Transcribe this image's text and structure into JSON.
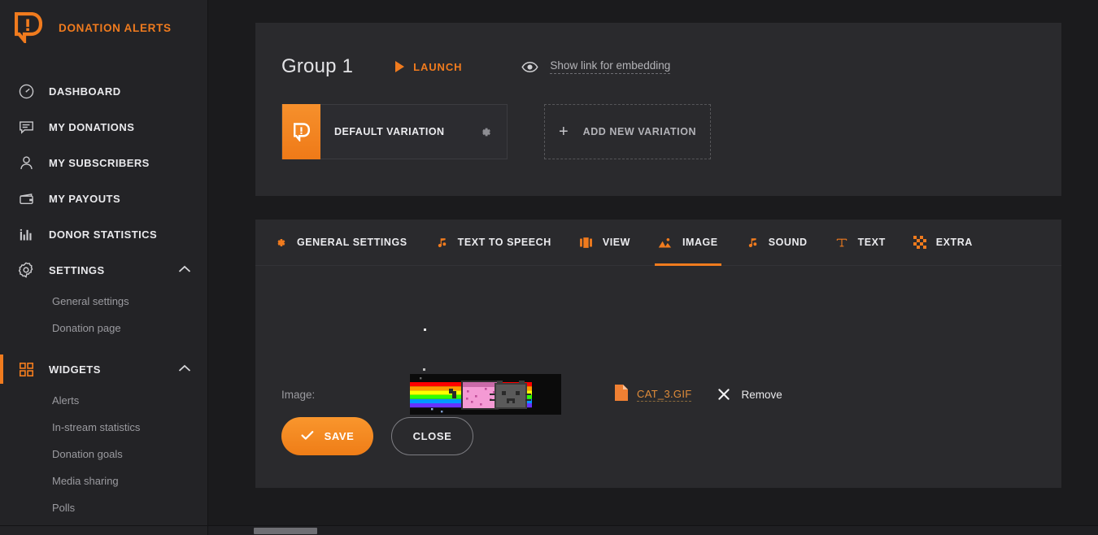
{
  "brand": {
    "name": "DONATION ALERTS",
    "logo_icon": "donation-alerts-logo-icon",
    "accent": "#f07b1e"
  },
  "sidebar": {
    "items": [
      {
        "label": "DASHBOARD",
        "icon": "speedometer-icon"
      },
      {
        "label": "MY DONATIONS",
        "icon": "chat-bubble-icon"
      },
      {
        "label": "MY SUBSCRIBERS",
        "icon": "user-icon"
      },
      {
        "label": "MY PAYOUTS",
        "icon": "wallet-icon"
      },
      {
        "label": "DONOR STATISTICS",
        "icon": "bar-chart-icon"
      },
      {
        "label": "SETTINGS",
        "icon": "gear-icon",
        "chevron": "chevron-up-icon"
      }
    ],
    "settings_children": [
      {
        "label": "General settings"
      },
      {
        "label": "Donation page"
      }
    ],
    "widgets": {
      "label": "WIDGETS",
      "icon": "grid-squares-icon",
      "chevron": "chevron-up-icon",
      "active": true
    },
    "widgets_children": [
      {
        "label": "Alerts"
      },
      {
        "label": "In-stream statistics"
      },
      {
        "label": "Donation goals"
      },
      {
        "label": "Media sharing"
      },
      {
        "label": "Polls"
      }
    ]
  },
  "header": {
    "group_title": "Group 1",
    "launch_label": "LAUNCH",
    "launch_icon": "play-triangle-icon",
    "embed_label": "Show link for embedding",
    "embed_icon": "eye-icon"
  },
  "variations": {
    "default": {
      "label": "DEFAULT VARIATION",
      "badge_icon": "donation-alerts-logo-icon",
      "gear_icon": "gear-icon"
    },
    "add": {
      "label": "ADD NEW VARIATION",
      "plus_icon": "plus-icon"
    }
  },
  "tabs": [
    {
      "label": "GENERAL SETTINGS",
      "icon": "gear-icon",
      "active": false
    },
    {
      "label": "TEXT TO SPEECH",
      "icon": "music-note-icon",
      "active": false
    },
    {
      "label": "VIEW",
      "icon": "layout-icon",
      "active": false
    },
    {
      "label": "IMAGE",
      "icon": "image-icon",
      "active": true
    },
    {
      "label": "SOUND",
      "icon": "music-note-icon",
      "active": false
    },
    {
      "label": "TEXT",
      "icon": "text-t-icon",
      "active": false
    },
    {
      "label": "EXTRA",
      "icon": "checker-grid-icon",
      "active": false
    }
  ],
  "form": {
    "image_label": "Image:",
    "thumbnail_alt": "nyan-cat-gif-preview",
    "file_name": "CAT_3.GIF",
    "file_icon": "file-document-icon",
    "remove_label": "Remove",
    "remove_icon": "close-x-icon",
    "save_label": "SAVE",
    "save_icon": "check-icon",
    "close_label": "CLOSE"
  }
}
